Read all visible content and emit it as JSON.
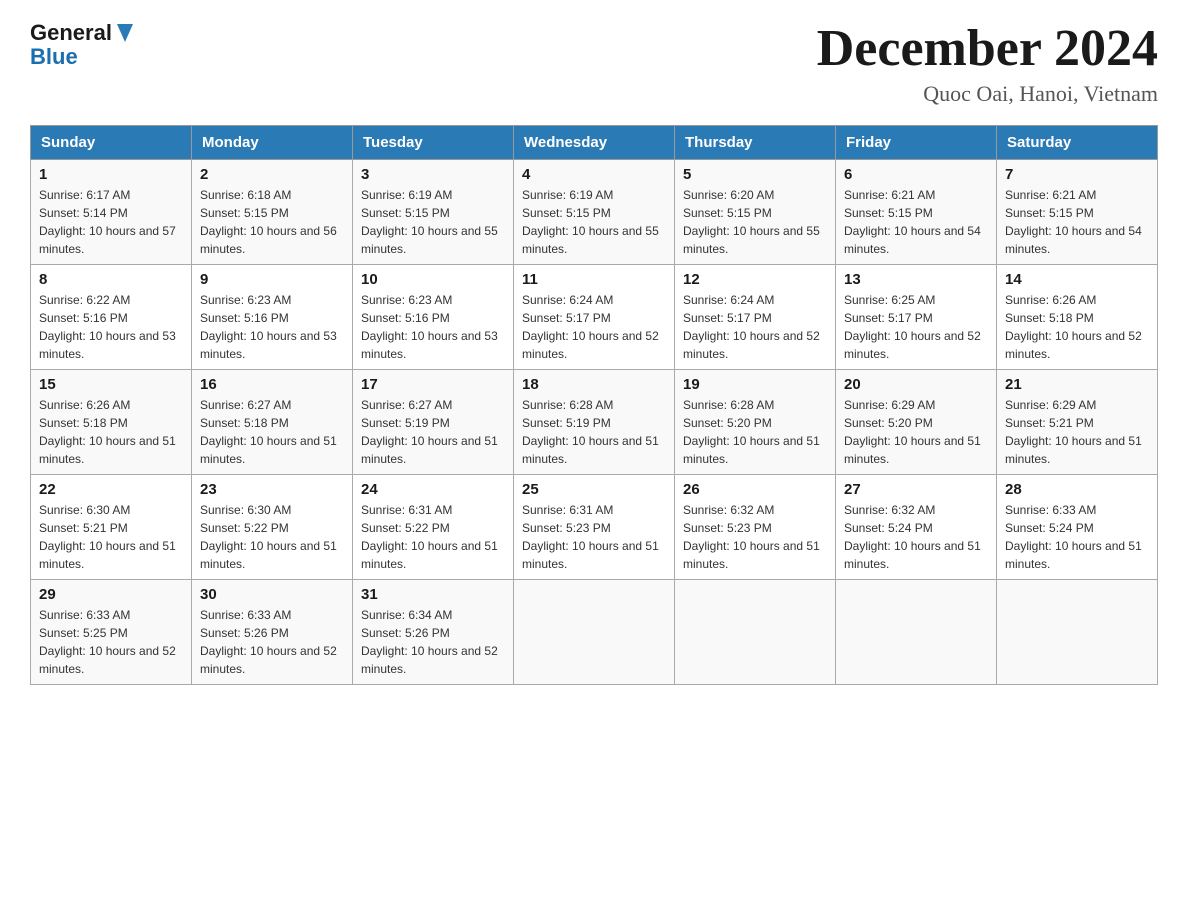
{
  "header": {
    "logo_general": "General",
    "logo_blue": "Blue",
    "month_title": "December 2024",
    "location": "Quoc Oai, Hanoi, Vietnam"
  },
  "days_of_week": [
    "Sunday",
    "Monday",
    "Tuesday",
    "Wednesday",
    "Thursday",
    "Friday",
    "Saturday"
  ],
  "weeks": [
    [
      {
        "day": "1",
        "sunrise": "6:17 AM",
        "sunset": "5:14 PM",
        "daylight": "10 hours and 57 minutes."
      },
      {
        "day": "2",
        "sunrise": "6:18 AM",
        "sunset": "5:15 PM",
        "daylight": "10 hours and 56 minutes."
      },
      {
        "day": "3",
        "sunrise": "6:19 AM",
        "sunset": "5:15 PM",
        "daylight": "10 hours and 55 minutes."
      },
      {
        "day": "4",
        "sunrise": "6:19 AM",
        "sunset": "5:15 PM",
        "daylight": "10 hours and 55 minutes."
      },
      {
        "day": "5",
        "sunrise": "6:20 AM",
        "sunset": "5:15 PM",
        "daylight": "10 hours and 55 minutes."
      },
      {
        "day": "6",
        "sunrise": "6:21 AM",
        "sunset": "5:15 PM",
        "daylight": "10 hours and 54 minutes."
      },
      {
        "day": "7",
        "sunrise": "6:21 AM",
        "sunset": "5:15 PM",
        "daylight": "10 hours and 54 minutes."
      }
    ],
    [
      {
        "day": "8",
        "sunrise": "6:22 AM",
        "sunset": "5:16 PM",
        "daylight": "10 hours and 53 minutes."
      },
      {
        "day": "9",
        "sunrise": "6:23 AM",
        "sunset": "5:16 PM",
        "daylight": "10 hours and 53 minutes."
      },
      {
        "day": "10",
        "sunrise": "6:23 AM",
        "sunset": "5:16 PM",
        "daylight": "10 hours and 53 minutes."
      },
      {
        "day": "11",
        "sunrise": "6:24 AM",
        "sunset": "5:17 PM",
        "daylight": "10 hours and 52 minutes."
      },
      {
        "day": "12",
        "sunrise": "6:24 AM",
        "sunset": "5:17 PM",
        "daylight": "10 hours and 52 minutes."
      },
      {
        "day": "13",
        "sunrise": "6:25 AM",
        "sunset": "5:17 PM",
        "daylight": "10 hours and 52 minutes."
      },
      {
        "day": "14",
        "sunrise": "6:26 AM",
        "sunset": "5:18 PM",
        "daylight": "10 hours and 52 minutes."
      }
    ],
    [
      {
        "day": "15",
        "sunrise": "6:26 AM",
        "sunset": "5:18 PM",
        "daylight": "10 hours and 51 minutes."
      },
      {
        "day": "16",
        "sunrise": "6:27 AM",
        "sunset": "5:18 PM",
        "daylight": "10 hours and 51 minutes."
      },
      {
        "day": "17",
        "sunrise": "6:27 AM",
        "sunset": "5:19 PM",
        "daylight": "10 hours and 51 minutes."
      },
      {
        "day": "18",
        "sunrise": "6:28 AM",
        "sunset": "5:19 PM",
        "daylight": "10 hours and 51 minutes."
      },
      {
        "day": "19",
        "sunrise": "6:28 AM",
        "sunset": "5:20 PM",
        "daylight": "10 hours and 51 minutes."
      },
      {
        "day": "20",
        "sunrise": "6:29 AM",
        "sunset": "5:20 PM",
        "daylight": "10 hours and 51 minutes."
      },
      {
        "day": "21",
        "sunrise": "6:29 AM",
        "sunset": "5:21 PM",
        "daylight": "10 hours and 51 minutes."
      }
    ],
    [
      {
        "day": "22",
        "sunrise": "6:30 AM",
        "sunset": "5:21 PM",
        "daylight": "10 hours and 51 minutes."
      },
      {
        "day": "23",
        "sunrise": "6:30 AM",
        "sunset": "5:22 PM",
        "daylight": "10 hours and 51 minutes."
      },
      {
        "day": "24",
        "sunrise": "6:31 AM",
        "sunset": "5:22 PM",
        "daylight": "10 hours and 51 minutes."
      },
      {
        "day": "25",
        "sunrise": "6:31 AM",
        "sunset": "5:23 PM",
        "daylight": "10 hours and 51 minutes."
      },
      {
        "day": "26",
        "sunrise": "6:32 AM",
        "sunset": "5:23 PM",
        "daylight": "10 hours and 51 minutes."
      },
      {
        "day": "27",
        "sunrise": "6:32 AM",
        "sunset": "5:24 PM",
        "daylight": "10 hours and 51 minutes."
      },
      {
        "day": "28",
        "sunrise": "6:33 AM",
        "sunset": "5:24 PM",
        "daylight": "10 hours and 51 minutes."
      }
    ],
    [
      {
        "day": "29",
        "sunrise": "6:33 AM",
        "sunset": "5:25 PM",
        "daylight": "10 hours and 52 minutes."
      },
      {
        "day": "30",
        "sunrise": "6:33 AM",
        "sunset": "5:26 PM",
        "daylight": "10 hours and 52 minutes."
      },
      {
        "day": "31",
        "sunrise": "6:34 AM",
        "sunset": "5:26 PM",
        "daylight": "10 hours and 52 minutes."
      },
      null,
      null,
      null,
      null
    ]
  ]
}
